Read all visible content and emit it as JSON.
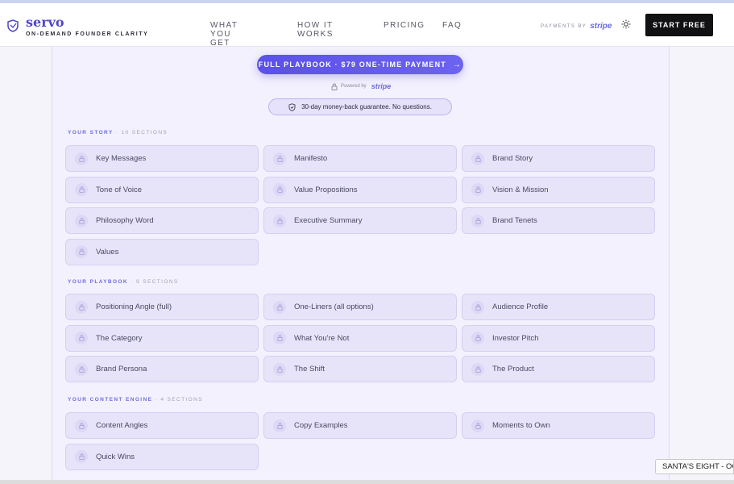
{
  "brand": {
    "name": "servo",
    "tagline": "ON-DEMAND FOUNDER CLARITY"
  },
  "nav": [
    {
      "label": "WHAT YOU GET"
    },
    {
      "label": "HOW IT WORKS"
    },
    {
      "label": "PRICING"
    },
    {
      "label": "FAQ"
    }
  ],
  "header": {
    "payments_label": "PAYMENTS BY",
    "payments_brand": "stripe",
    "cta_label": "START FREE"
  },
  "checkout": {
    "pay_button": "FULL PLAYBOOK · $79 ONE-TIME PAYMENT",
    "pay_arrow": "→",
    "powered_by": "Powered by",
    "powered_brand": "stripe",
    "guarantee": "30-day money-back guarantee. No questions."
  },
  "sections": [
    {
      "title": "YOUR STORY",
      "count": "· 10 SECTIONS",
      "items": [
        "Key Messages",
        "Manifesto",
        "Brand Story",
        "Tone of Voice",
        "Value Propositions",
        "Vision & Mission",
        "Philosophy Word",
        "Executive Summary",
        "Brand Tenets",
        "Values"
      ]
    },
    {
      "title": "YOUR PLAYBOOK",
      "count": "· 9 SECTIONS",
      "items": [
        "Positioning Angle (full)",
        "One-Liners (all options)",
        "Audience Profile",
        "The Category",
        "What You're Not",
        "Investor Pitch",
        "Brand Persona",
        "The Shift",
        "The Product"
      ]
    },
    {
      "title": "YOUR CONTENT ENGINE",
      "count": "· 4 SECTIONS",
      "items": [
        "Content Angles",
        "Copy Examples",
        "Moments to Own",
        "Quick Wins"
      ]
    }
  ],
  "toast": {
    "text": "SANTA'S EIGHT - OC"
  },
  "colors": {
    "accent": "#5b50e8",
    "tile_bg": "#e7e4fa",
    "cta_bg": "#111114"
  }
}
